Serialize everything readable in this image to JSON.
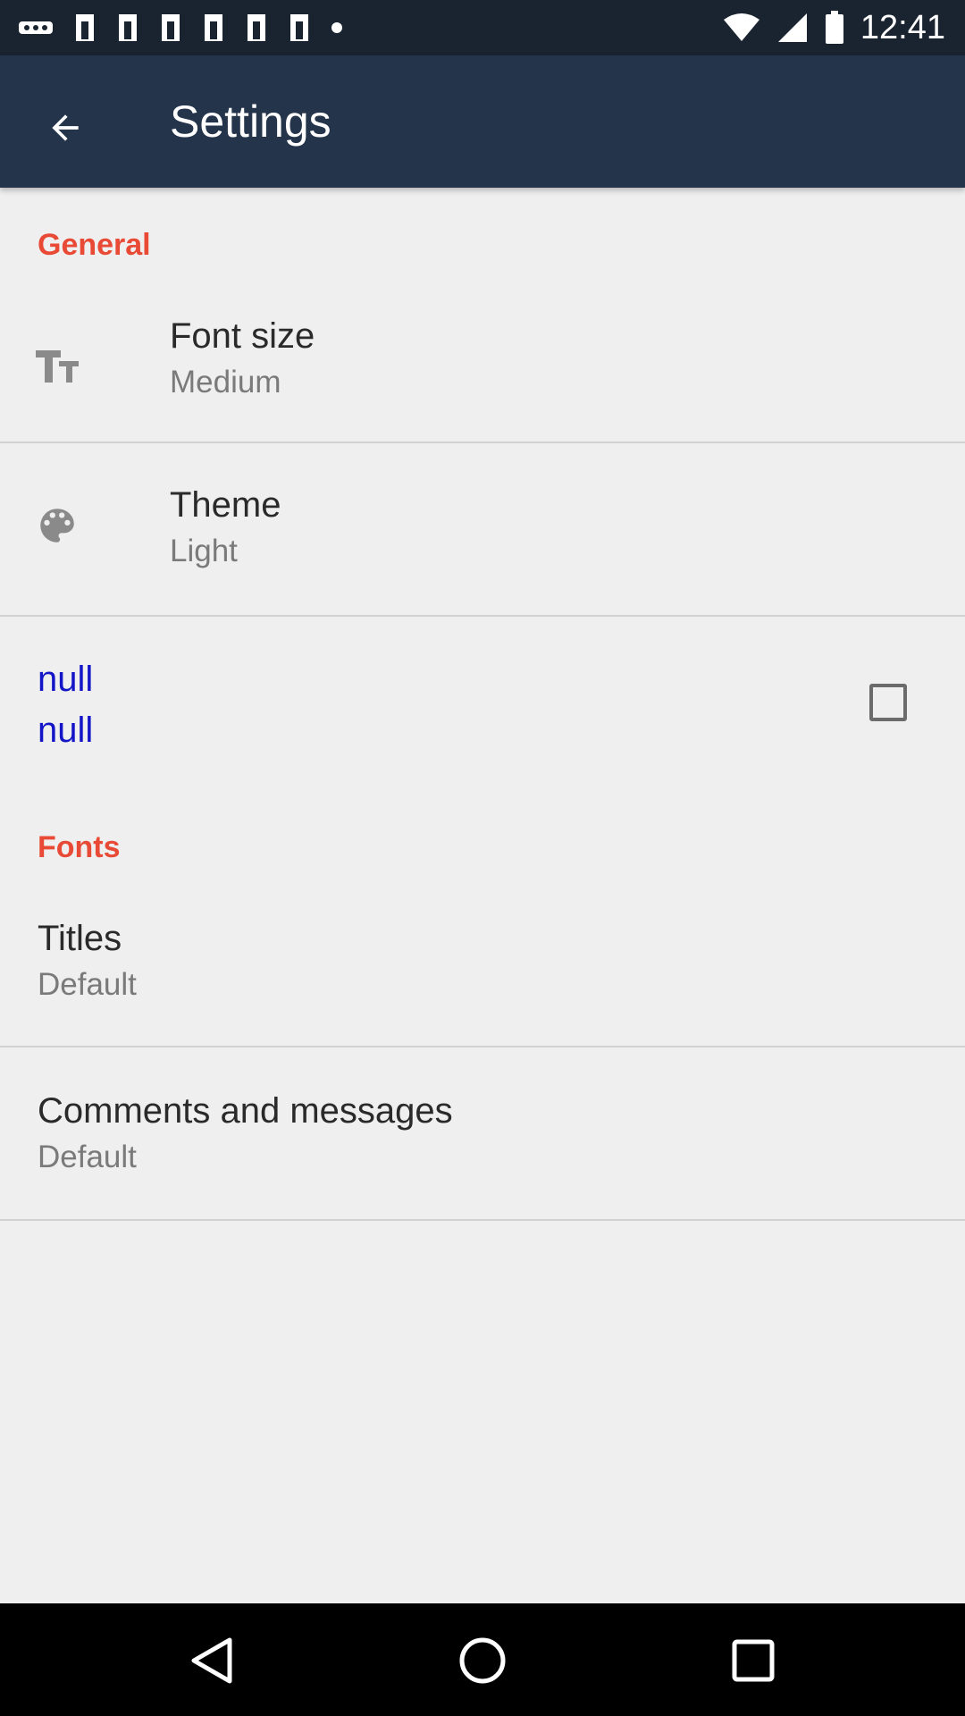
{
  "status_bar": {
    "time": "12:41",
    "left_icons": [
      "more-dots-icon",
      "notification-icon",
      "notification-icon",
      "notification-icon",
      "notification-icon",
      "notification-icon",
      "notification-icon",
      "dot-icon"
    ],
    "right_icons": [
      "wifi-icon",
      "signal-icon",
      "battery-icon"
    ]
  },
  "app_bar": {
    "title": "Settings",
    "back_icon": "arrow-back-icon",
    "background": "#24344a"
  },
  "sections": {
    "general": {
      "header": "General"
    },
    "fonts": {
      "header": "Fonts"
    }
  },
  "general_items": {
    "font_size": {
      "title": "Font size",
      "summary": "Medium",
      "icon": "text-size-icon"
    },
    "theme": {
      "title": "Theme",
      "summary": "Light",
      "icon": "palette-icon"
    },
    "null_item": {
      "title": "null",
      "summary": "null",
      "checked": false
    }
  },
  "font_items": {
    "titles": {
      "title": "Titles",
      "summary": "Default"
    },
    "comments": {
      "title": "Comments and messages",
      "summary": "Default"
    }
  },
  "colors": {
    "section_header": "#e84a35",
    "null_text": "#1515c8",
    "background": "#efefef"
  },
  "nav_bar": {
    "icons": [
      "back-triangle-icon",
      "home-circle-icon",
      "recents-square-icon"
    ]
  }
}
